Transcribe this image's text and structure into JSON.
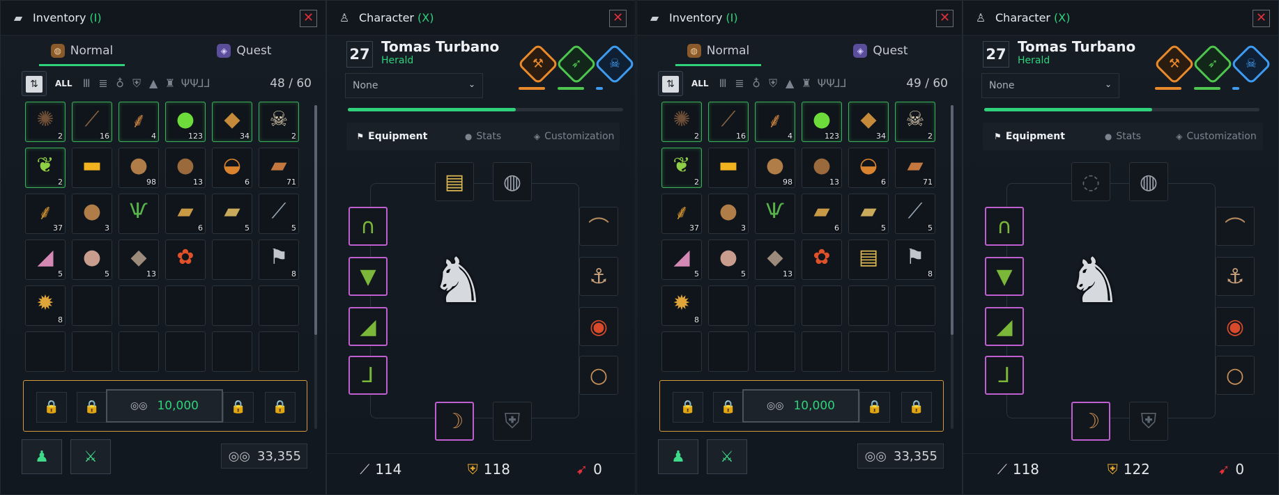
{
  "left": {
    "inventory": {
      "title": "Inventory",
      "hotkey": "(I)",
      "close": "✕",
      "tabs": [
        {
          "label": "Normal",
          "icon": "pouch-icon"
        },
        {
          "label": "Quest",
          "icon": "quest-icon"
        }
      ],
      "filter_all": "ALL",
      "capacity": "48 / 60",
      "items": [
        {
          "glyph": "✺",
          "qty": "2",
          "color": "#6f4f37",
          "green": true
        },
        {
          "glyph": "⟋",
          "qty": "16",
          "color": "#8a6440",
          "green": true
        },
        {
          "glyph": "⸙",
          "qty": "4",
          "color": "#c6813d",
          "green": true
        },
        {
          "glyph": "●",
          "qty": "123",
          "color": "#6ddc3a",
          "green": true
        },
        {
          "glyph": "◆",
          "qty": "34",
          "color": "#c58a3a",
          "green": true
        },
        {
          "glyph": "☠",
          "qty": "2",
          "color": "#d8c9ae",
          "green": true
        },
        {
          "glyph": "❦",
          "qty": "2",
          "color": "#8fcf45",
          "green": true
        },
        {
          "glyph": "▬",
          "qty": "",
          "color": "#f1b320",
          "green": false
        },
        {
          "glyph": "●",
          "qty": "98",
          "color": "#b07c48",
          "green": false
        },
        {
          "glyph": "●",
          "qty": "13",
          "color": "#9a6a3c",
          "green": false
        },
        {
          "glyph": "◒",
          "qty": "6",
          "color": "#d9832f",
          "green": false
        },
        {
          "glyph": "▰",
          "qty": "71",
          "color": "#c4773f",
          "green": false
        },
        {
          "glyph": "⸙",
          "qty": "37",
          "color": "#d2922e",
          "green": false
        },
        {
          "glyph": "●",
          "qty": "3",
          "color": "#b07c48",
          "green": false
        },
        {
          "glyph": "Ѱ",
          "qty": "",
          "color": "#58b34a",
          "green": false
        },
        {
          "glyph": "▰",
          "qty": "6",
          "color": "#c99a45",
          "green": false
        },
        {
          "glyph": "▰",
          "qty": "5",
          "color": "#c9aa5a",
          "green": false
        },
        {
          "glyph": "⟋",
          "qty": "5",
          "color": "#9aa7b6",
          "green": false
        },
        {
          "glyph": "◢",
          "qty": "5",
          "color": "#d488b4",
          "green": false
        },
        {
          "glyph": "●",
          "qty": "5",
          "color": "#c89d8e",
          "green": false
        },
        {
          "glyph": "◆",
          "qty": "13",
          "color": "#9c8a7a",
          "green": false
        },
        {
          "glyph": "✿",
          "qty": "",
          "color": "#e0512a",
          "green": false
        },
        {
          "glyph": "",
          "qty": "",
          "color": "#000",
          "green": false
        },
        {
          "glyph": "⚑",
          "qty": "8",
          "color": "#c2c6cc",
          "green": false
        },
        {
          "glyph": "✹",
          "qty": "8",
          "color": "#e0a53a",
          "green": false
        },
        {
          "glyph": "",
          "qty": "",
          "color": "#000",
          "green": false
        },
        {
          "glyph": "",
          "qty": "",
          "color": "#000",
          "green": false
        },
        {
          "glyph": "",
          "qty": "",
          "color": "#000",
          "green": false
        },
        {
          "glyph": "",
          "qty": "",
          "color": "#000",
          "green": false
        },
        {
          "glyph": "",
          "qty": "",
          "color": "#000",
          "green": false
        },
        {
          "glyph": "",
          "qty": "",
          "color": "#000",
          "green": false
        },
        {
          "glyph": "",
          "qty": "",
          "color": "#000",
          "green": false
        },
        {
          "glyph": "",
          "qty": "",
          "color": "#000",
          "green": false
        },
        {
          "glyph": "",
          "qty": "",
          "color": "#000",
          "green": false
        },
        {
          "glyph": "",
          "qty": "",
          "color": "#000",
          "green": false
        },
        {
          "glyph": "",
          "qty": "",
          "color": "#000",
          "green": false
        }
      ],
      "stash_gold": "10,000",
      "money": "33,355"
    },
    "character": {
      "title": "Character",
      "hotkey": "(X)",
      "close": "✕",
      "level": "27",
      "name": "Tomas Turbano",
      "class": "Herald",
      "dropdown": "None",
      "tabs": [
        "Equipment",
        "Stats",
        "Customization"
      ],
      "stats": {
        "attack": "114",
        "defense": "118",
        "other": "0"
      },
      "amulet_glyph": "▤",
      "amulet_color": "#d9b650",
      "amulet_empty": false
    }
  },
  "right": {
    "inventory": {
      "title": "Inventory",
      "hotkey": "(I)",
      "close": "✕",
      "tabs": [
        {
          "label": "Normal",
          "icon": "pouch-icon"
        },
        {
          "label": "Quest",
          "icon": "quest-icon"
        }
      ],
      "filter_all": "ALL",
      "capacity": "49 / 60",
      "items": [
        {
          "glyph": "✺",
          "qty": "2",
          "color": "#6f4f37",
          "green": true
        },
        {
          "glyph": "⟋",
          "qty": "16",
          "color": "#8a6440",
          "green": true
        },
        {
          "glyph": "⸙",
          "qty": "4",
          "color": "#c6813d",
          "green": true
        },
        {
          "glyph": "●",
          "qty": "123",
          "color": "#6ddc3a",
          "green": true
        },
        {
          "glyph": "◆",
          "qty": "34",
          "color": "#c58a3a",
          "green": true
        },
        {
          "glyph": "☠",
          "qty": "2",
          "color": "#d8c9ae",
          "green": true
        },
        {
          "glyph": "❦",
          "qty": "2",
          "color": "#8fcf45",
          "green": true
        },
        {
          "glyph": "▬",
          "qty": "",
          "color": "#f1b320",
          "green": false
        },
        {
          "glyph": "●",
          "qty": "98",
          "color": "#b07c48",
          "green": false
        },
        {
          "glyph": "●",
          "qty": "13",
          "color": "#9a6a3c",
          "green": false
        },
        {
          "glyph": "◒",
          "qty": "6",
          "color": "#d9832f",
          "green": false
        },
        {
          "glyph": "▰",
          "qty": "71",
          "color": "#c4773f",
          "green": false
        },
        {
          "glyph": "⸙",
          "qty": "37",
          "color": "#d2922e",
          "green": false
        },
        {
          "glyph": "●",
          "qty": "3",
          "color": "#b07c48",
          "green": false
        },
        {
          "glyph": "Ѱ",
          "qty": "",
          "color": "#58b34a",
          "green": false
        },
        {
          "glyph": "▰",
          "qty": "6",
          "color": "#c99a45",
          "green": false
        },
        {
          "glyph": "▰",
          "qty": "5",
          "color": "#c9aa5a",
          "green": false
        },
        {
          "glyph": "⟋",
          "qty": "5",
          "color": "#9aa7b6",
          "green": false
        },
        {
          "glyph": "◢",
          "qty": "5",
          "color": "#d488b4",
          "green": false
        },
        {
          "glyph": "●",
          "qty": "5",
          "color": "#c89d8e",
          "green": false
        },
        {
          "glyph": "◆",
          "qty": "13",
          "color": "#9c8a7a",
          "green": false
        },
        {
          "glyph": "✿",
          "qty": "",
          "color": "#e0512a",
          "green": false
        },
        {
          "glyph": "▤",
          "qty": "",
          "color": "#d9b650",
          "green": false
        },
        {
          "glyph": "⚑",
          "qty": "8",
          "color": "#c2c6cc",
          "green": false
        },
        {
          "glyph": "✹",
          "qty": "8",
          "color": "#e0a53a",
          "green": false
        },
        {
          "glyph": "",
          "qty": "",
          "color": "#000",
          "green": false
        },
        {
          "glyph": "",
          "qty": "",
          "color": "#000",
          "green": false
        },
        {
          "glyph": "",
          "qty": "",
          "color": "#000",
          "green": false
        },
        {
          "glyph": "",
          "qty": "",
          "color": "#000",
          "green": false
        },
        {
          "glyph": "",
          "qty": "",
          "color": "#000",
          "green": false
        },
        {
          "glyph": "",
          "qty": "",
          "color": "#000",
          "green": false
        },
        {
          "glyph": "",
          "qty": "",
          "color": "#000",
          "green": false
        },
        {
          "glyph": "",
          "qty": "",
          "color": "#000",
          "green": false
        },
        {
          "glyph": "",
          "qty": "",
          "color": "#000",
          "green": false
        },
        {
          "glyph": "",
          "qty": "",
          "color": "#000",
          "green": false
        },
        {
          "glyph": "",
          "qty": "",
          "color": "#000",
          "green": false
        }
      ],
      "stash_gold": "10,000",
      "money": "33,355"
    },
    "character": {
      "title": "Character",
      "hotkey": "(X)",
      "close": "✕",
      "level": "27",
      "name": "Tomas Turbano",
      "class": "Herald",
      "dropdown": "None",
      "tabs": [
        "Equipment",
        "Stats",
        "Customization"
      ],
      "stats": {
        "attack": "118",
        "defense": "122",
        "other": "0"
      },
      "amulet_glyph": "◌",
      "amulet_color": "#5d6570",
      "amulet_empty": true
    }
  },
  "colors": {
    "accent": "#2fd27a",
    "stash_border": "#d79a3b",
    "equipped_border": "#c05fd0",
    "close": "#e0303a"
  }
}
